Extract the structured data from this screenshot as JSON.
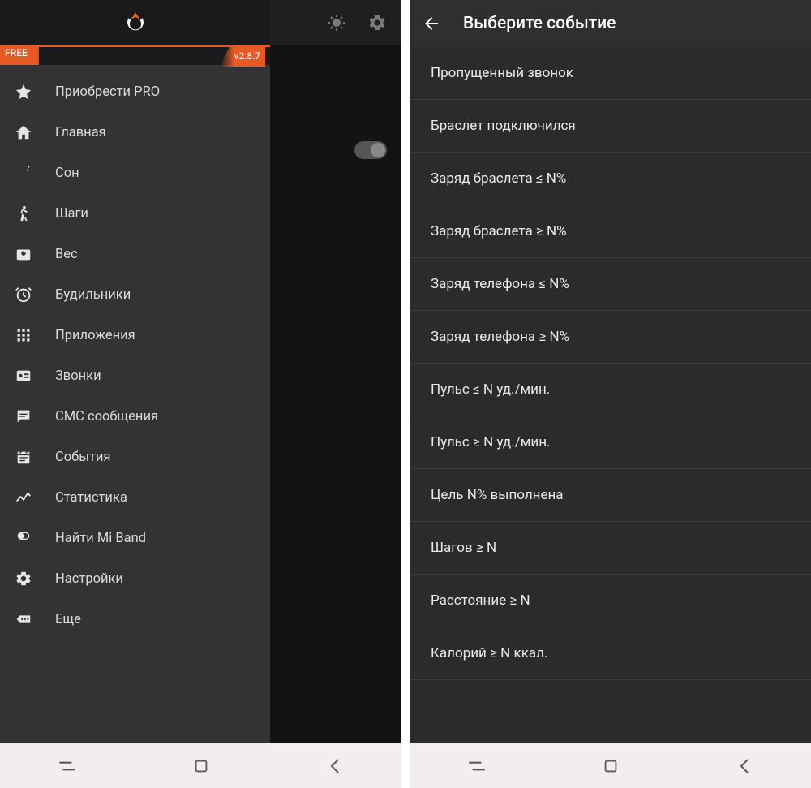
{
  "left": {
    "free_badge": "FREE",
    "version": "v2.8.7",
    "menu": [
      {
        "icon": "star",
        "label": "Приобрести PRO"
      },
      {
        "icon": "home",
        "label": "Главная"
      },
      {
        "icon": "moon",
        "label": "Сон"
      },
      {
        "icon": "walk",
        "label": "Шаги"
      },
      {
        "icon": "weight",
        "label": "Вес"
      },
      {
        "icon": "alarm",
        "label": "Будильники"
      },
      {
        "icon": "apps",
        "label": "Приложения"
      },
      {
        "icon": "calls",
        "label": "Звонки"
      },
      {
        "icon": "sms",
        "label": "СМС сообщения"
      },
      {
        "icon": "events",
        "label": "События"
      },
      {
        "icon": "stats",
        "label": "Статистика"
      },
      {
        "icon": "find",
        "label": "Найти Mi Band"
      },
      {
        "icon": "settings",
        "label": "Настройки"
      },
      {
        "icon": "more",
        "label": "Еще"
      }
    ]
  },
  "right": {
    "title": "Выберите событие",
    "events": [
      "Пропущенный звонок",
      "Браслет подключился",
      "Заряд браслета ≤ N%",
      "Заряд браслета ≥ N%",
      "Заряд телефона ≤ N%",
      "Заряд телефона ≥ N%",
      "Пульс ≤ N уд./мин.",
      "Пульс ≥ N уд./мин.",
      "Цель N% выполнена",
      "Шагов ≥ N",
      "Расстояние ≥ N",
      "Калорий ≥ N ккал."
    ]
  }
}
